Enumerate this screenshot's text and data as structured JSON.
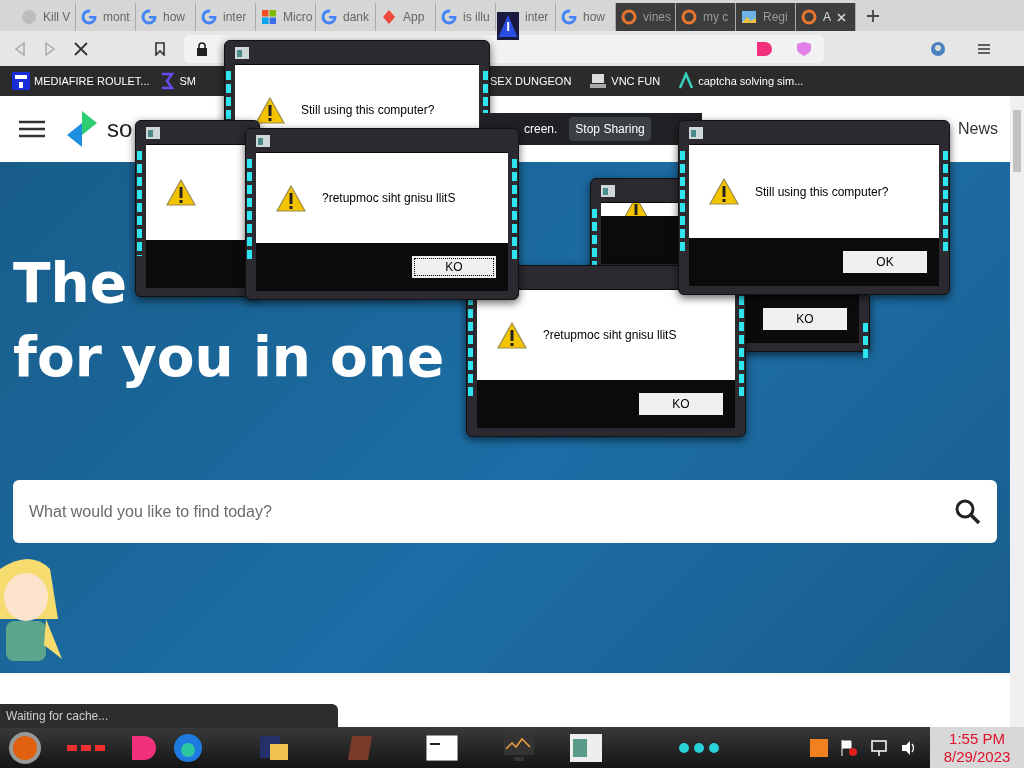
{
  "tabs": [
    {
      "label": "Kill V",
      "kind": "globe",
      "selected": false,
      "grouped": false
    },
    {
      "label": "mont",
      "kind": "g",
      "selected": false,
      "grouped": false
    },
    {
      "label": "how",
      "kind": "g",
      "selected": false,
      "grouped": false
    },
    {
      "label": "inter",
      "kind": "g",
      "selected": false,
      "grouped": false
    },
    {
      "label": "Micro",
      "kind": "squares",
      "selected": false,
      "grouped": false
    },
    {
      "label": "dank",
      "kind": "g",
      "selected": false,
      "grouped": false
    },
    {
      "label": "App",
      "kind": "flame",
      "selected": false,
      "grouped": false
    },
    {
      "label": "is illu",
      "kind": "g",
      "selected": false,
      "grouped": false
    },
    {
      "label": "inter",
      "kind": "none",
      "selected": false,
      "grouped": false
    },
    {
      "label": "how",
      "kind": "g",
      "selected": false,
      "grouped": false
    },
    {
      "label": "vines",
      "kind": "ring",
      "selected": false,
      "grouped": true
    },
    {
      "label": "my c",
      "kind": "ring",
      "selected": false,
      "grouped": true
    },
    {
      "label": "Regi",
      "kind": "photo",
      "selected": false,
      "grouped": true
    },
    {
      "label": "A",
      "kind": "ring",
      "selected": true,
      "grouped": true
    }
  ],
  "bookmarks": [
    {
      "label": "MEDIAFIRE ROULET...",
      "kind": "mf"
    },
    {
      "label": "SM",
      "kind": "bracket"
    },
    {
      "label": "SEX DUNGEON",
      "kind": "none"
    },
    {
      "label": "VNC FUN",
      "kind": "computer"
    },
    {
      "label": "captcha solving sim...",
      "kind": "lambda"
    }
  ],
  "page": {
    "logo_text": "so",
    "nav_link": "News",
    "headline": [
      "The",
      "for you in one"
    ],
    "search": {
      "placeholder": "What would you like to find today?"
    }
  },
  "share_bar": {
    "message": "creen.",
    "button": "Stop Sharing"
  },
  "dialogs": [
    {
      "kind": "alert",
      "message": "Still using this computer?"
    },
    {
      "kind": "alert"
    },
    {
      "kind": "alert",
      "message": "?retupmoc siht gnisu llitS",
      "button": "KO",
      "focused": true
    },
    {
      "kind": "alert"
    },
    {
      "button": "KO",
      "focused": false
    },
    {
      "kind": "alert",
      "message": "?retupmoc siht gnisu llitS",
      "button": "KO",
      "focused": false
    },
    {
      "kind": "alert",
      "message": "Still using this computer?",
      "button": "OK",
      "focused": false
    }
  ],
  "status_bar": "Waiting for cache...",
  "clock": {
    "time": "1:55 PM",
    "date": "8/29/2023"
  }
}
